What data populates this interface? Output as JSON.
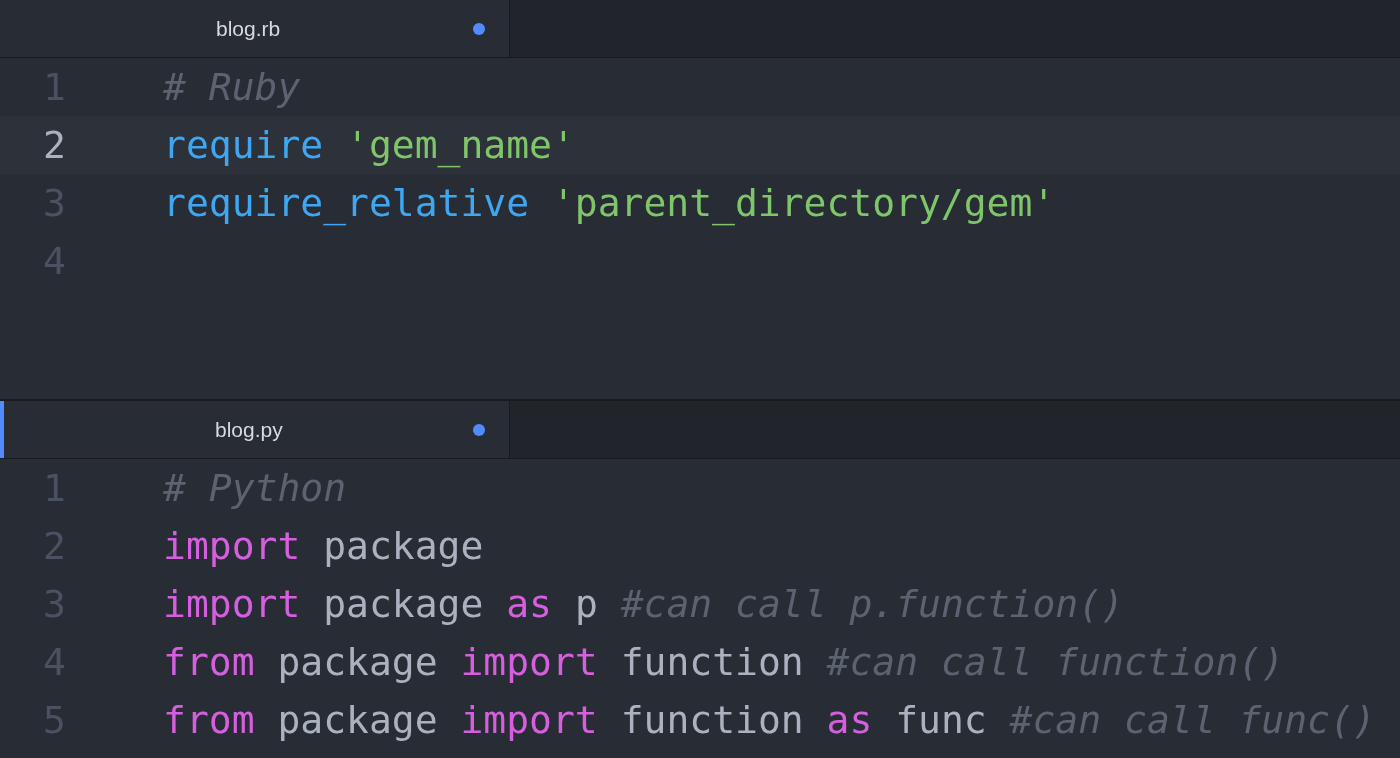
{
  "panes": [
    {
      "active": false,
      "tab": {
        "title": "blog.rb",
        "modified": true
      },
      "lines": [
        {
          "number": "1",
          "current": false,
          "tokens": [
            {
              "kind": "comment",
              "text": "# Ruby"
            }
          ]
        },
        {
          "number": "2",
          "current": true,
          "tokens": [
            {
              "kind": "function",
              "text": "require"
            },
            {
              "kind": "string",
              "text": "'gem_name'"
            }
          ]
        },
        {
          "number": "3",
          "current": false,
          "tokens": [
            {
              "kind": "function",
              "text": "require_relative"
            },
            {
              "kind": "string",
              "text": "'parent_directory/gem'"
            }
          ]
        },
        {
          "number": "4",
          "current": false
        }
      ]
    },
    {
      "active": true,
      "tab": {
        "title": "blog.py",
        "modified": true
      },
      "lines": [
        {
          "number": "1",
          "current": false,
          "tokens": [
            {
              "kind": "comment",
              "text": "# Python"
            }
          ]
        },
        {
          "number": "2",
          "current": false,
          "tokens": [
            {
              "kind": "keyword",
              "text": "import"
            },
            {
              "kind": "plain",
              "text": "package"
            }
          ]
        },
        {
          "number": "3",
          "current": false,
          "tokens": [
            {
              "kind": "keyword",
              "text": "import"
            },
            {
              "kind": "plain",
              "text": "package"
            },
            {
              "kind": "keyword",
              "text": "as"
            },
            {
              "kind": "plain",
              "text": "p"
            },
            {
              "kind": "comment",
              "text": "#can call p.function()"
            }
          ]
        },
        {
          "number": "4",
          "current": false,
          "tokens": [
            {
              "kind": "keyword",
              "text": "from"
            },
            {
              "kind": "plain",
              "text": "package"
            },
            {
              "kind": "keyword",
              "text": "import"
            },
            {
              "kind": "plain",
              "text": "function"
            },
            {
              "kind": "comment",
              "text": "#can call function()"
            }
          ]
        },
        {
          "number": "5",
          "current": false,
          "tokens": [
            {
              "kind": "keyword",
              "text": "from"
            },
            {
              "kind": "plain",
              "text": "package"
            },
            {
              "kind": "keyword",
              "text": "import"
            },
            {
              "kind": "plain",
              "text": "function"
            },
            {
              "kind": "keyword",
              "text": "as"
            },
            {
              "kind": "plain",
              "text": "func"
            },
            {
              "kind": "comment",
              "text": "#can call func()"
            }
          ]
        }
      ]
    }
  ]
}
